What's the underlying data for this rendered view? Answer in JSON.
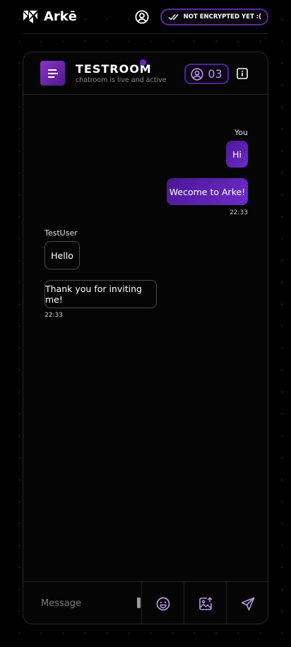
{
  "app": {
    "name": "Arkē"
  },
  "header": {
    "encryption_status": "NOT ENCRYPTED YET :("
  },
  "room": {
    "title": "TESTROOM",
    "subtitle": "chatroom is live and active",
    "member_count": "03"
  },
  "messages": {
    "outgoing_sender": "You",
    "outgoing": [
      "Hi",
      "Wecome to Arke!"
    ],
    "outgoing_time": "22:33",
    "incoming_sender": "TestUser",
    "incoming": [
      "Hello",
      "Thank you for inviting me!"
    ],
    "incoming_time": "22:33"
  },
  "composer": {
    "placeholder": "Message"
  },
  "colors": {
    "accent": "#6a24c4",
    "bubble_out": "#5a20b0",
    "background": "#000000"
  },
  "icons": [
    "arke-logo-icon",
    "user-circle-icon",
    "double-check-icon",
    "menu-lines-icon",
    "users-icon",
    "info-icon",
    "emoji-icon",
    "image-upload-icon",
    "send-icon"
  ]
}
